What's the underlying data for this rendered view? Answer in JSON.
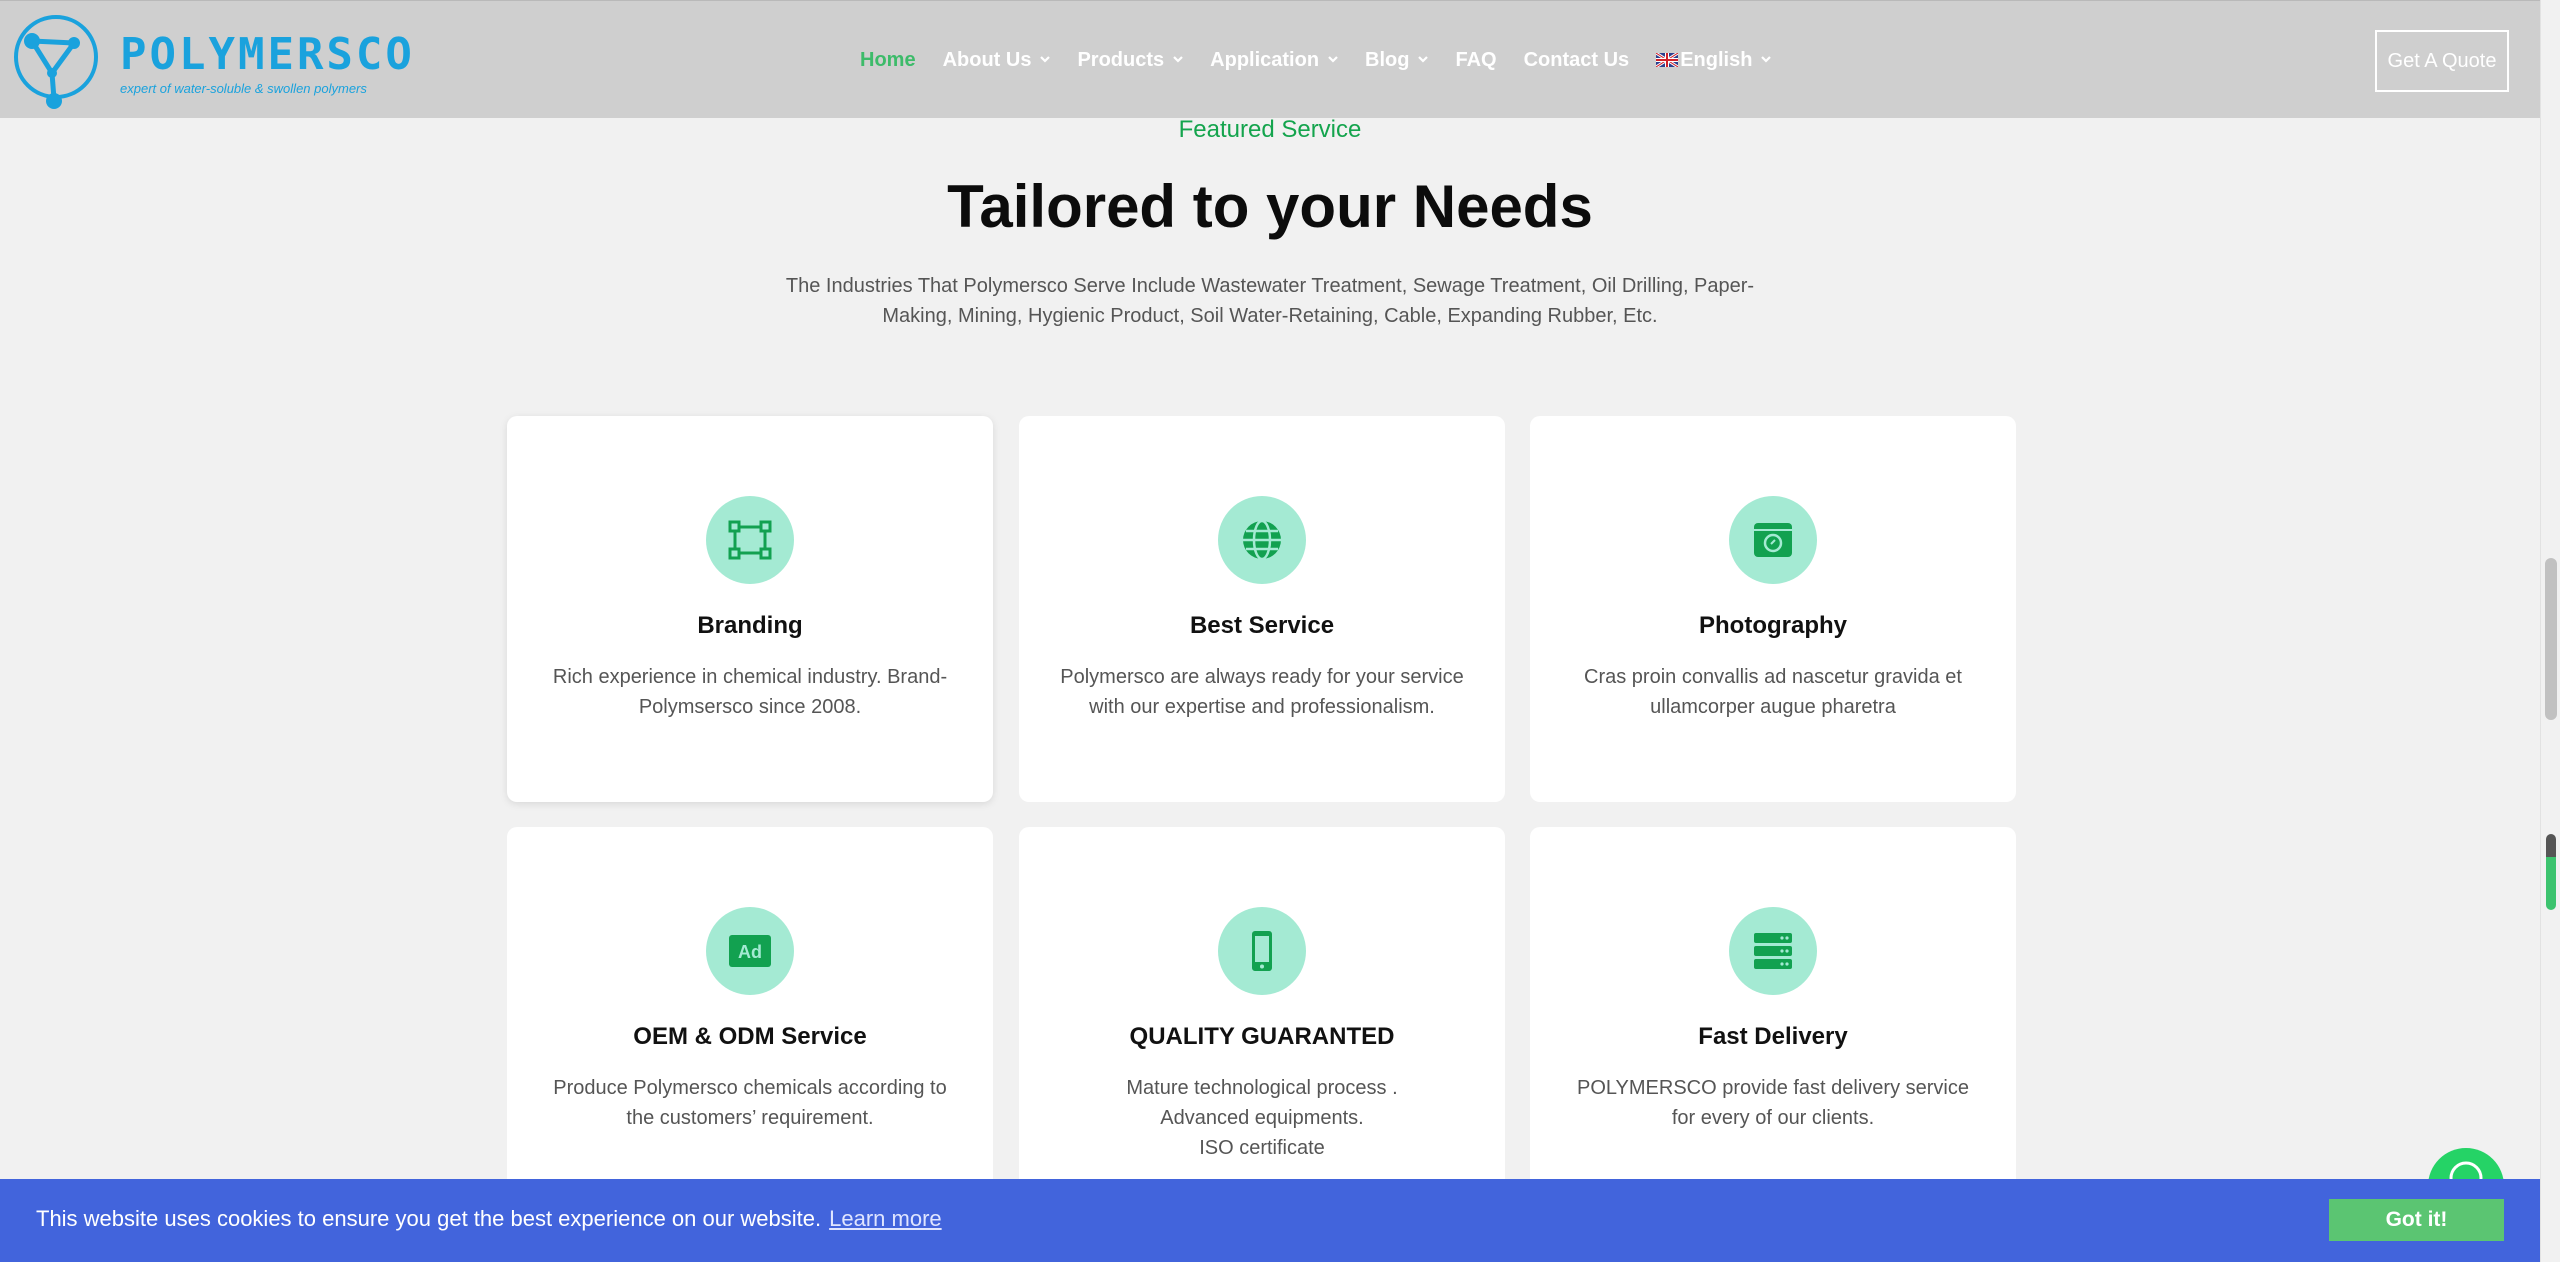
{
  "brand": {
    "name": "POLYMERSCO",
    "tagline": "expert of water-soluble & swollen polymers",
    "color": "#1aa2dd"
  },
  "nav": {
    "items": [
      {
        "label": "Home",
        "dropdown": false,
        "active": true
      },
      {
        "label": "About Us",
        "dropdown": true
      },
      {
        "label": "Products",
        "dropdown": true
      },
      {
        "label": "Application",
        "dropdown": true
      },
      {
        "label": "Blog",
        "dropdown": true
      },
      {
        "label": "FAQ",
        "dropdown": false
      },
      {
        "label": "Contact Us",
        "dropdown": false
      },
      {
        "label": "English",
        "dropdown": true,
        "icon": "uk-flag-icon"
      }
    ],
    "cta": "Get A Quote",
    "active_color": "#3dbb6a"
  },
  "section": {
    "eyebrow": "Featured Service",
    "title": "Tailored to your Needs",
    "intro": "The Industries That Polymersco Serve Include Wastewater Treatment, Sewage Treatment, Oil Drilling, Paper-Making, Mining, Hygienic Product, Soil Water-Retaining, Cable, Expanding Rubber, Etc."
  },
  "cards": [
    {
      "title": "Branding",
      "icon": "vector-shape-icon",
      "lines": [
        "Rich experience in chemical industry. Brand-Polymsersco since 2008."
      ]
    },
    {
      "title": "Best Service",
      "icon": "globe-icon",
      "lines": [
        "Polymersco are always ready for your service with our expertise and professionalism."
      ]
    },
    {
      "title": "Photography",
      "icon": "camera-window-icon",
      "lines": [
        "Cras proin convallis ad nascetur gravida et ullamcorper augue pharetra"
      ]
    },
    {
      "title": "OEM & ODM Service",
      "icon": "ad-icon",
      "lines": [
        "Produce Polymersco chemicals according to the customers’ requirement."
      ]
    },
    {
      "title": "QUALITY GUARANTED",
      "icon": "mobile-phone-icon",
      "lines": [
        "Mature technological process .",
        "Advanced equipments.",
        "ISO certificate"
      ]
    },
    {
      "title": "Fast Delivery",
      "icon": "server-stack-icon",
      "lines": [
        "POLYMERSCO provide fast delivery service for every of our clients."
      ]
    }
  ],
  "cookie": {
    "message": "This website uses cookies to ensure you get the best experience on our website.",
    "link": "Learn more",
    "button": "Got it!",
    "bar_color": "#4264dc",
    "button_color": "#5bc572"
  },
  "colors": {
    "accent_green": "#14a44d",
    "icon_circle": "#a4ead3",
    "icon_fg": "#12a150",
    "header_bg": "#cfcfcf",
    "page_bg": "#f1f1f1"
  }
}
